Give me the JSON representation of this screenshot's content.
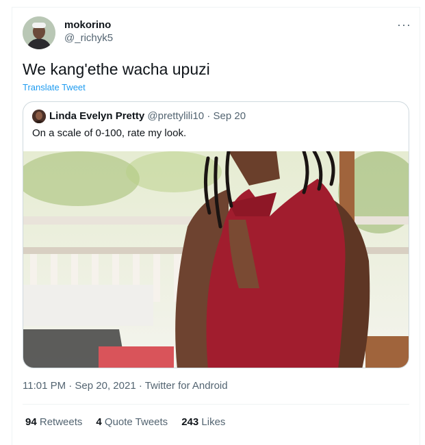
{
  "tweet": {
    "display_name": "mokorino",
    "handle": "@_richyk5",
    "more_glyph": "···",
    "text": "We kang'ethe wacha upuzi",
    "translate_label": "Translate Tweet",
    "timestamp": "11:01 PM · Sep 20, 2021 · Twitter for Android",
    "stats": {
      "retweets_count": "94",
      "retweets_label": "Retweets",
      "quotes_count": "4",
      "quotes_label": "Quote Tweets",
      "likes_count": "243",
      "likes_label": "Likes"
    }
  },
  "quoted": {
    "display_name": "Linda Evelyn Pretty",
    "handle": "@prettylili10",
    "date": "· Sep 20",
    "text": "On a scale of 0-100, rate my look."
  },
  "colors": {
    "accent": "#1d9bf0",
    "secondary_text": "#536471",
    "dress": "#a11d2e"
  }
}
